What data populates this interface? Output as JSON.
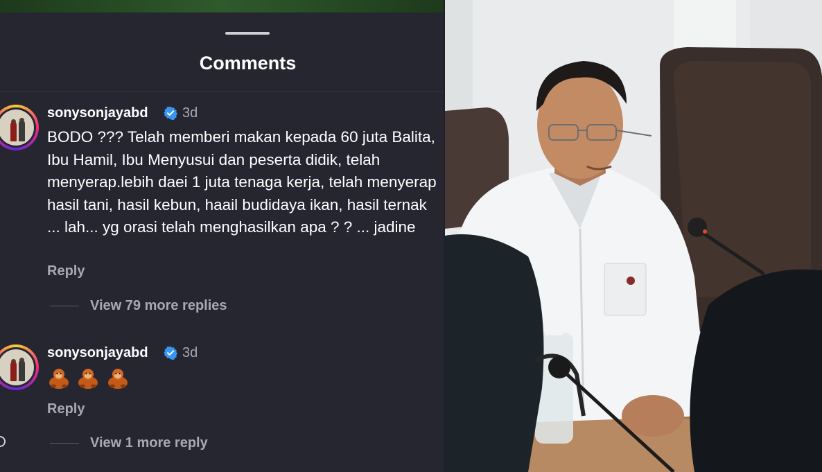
{
  "panel": {
    "title": "Comments"
  },
  "comments": [
    {
      "username": "sonysonjayabd",
      "verified": true,
      "time": "3d",
      "text": "BODO ??? Telah memberi makan kepada 60 juta Balita, Ibu Hamil, Ibu Menyusui dan peserta didik, telah menyerap.lebih daei 1 juta tenaga kerja, telah menyerap hasil tani, hasil kebun, haail budidaya ikan, hasil ternak ... lah... yg orasi telah menghasilkan apa ? ? ... jadine",
      "reply_label": "Reply",
      "view_replies_label": "View 79 more replies"
    },
    {
      "username": "sonysonjayabd",
      "verified": true,
      "time": "3d",
      "emojis": [
        "orangutan-icon",
        "orangutan-icon",
        "orangutan-icon"
      ],
      "reply_label": "Reply",
      "view_replies_label": "View 1 more reply"
    }
  ],
  "colors": {
    "panel_bg": "#262631",
    "verified_blue": "#3897f0",
    "muted_text": "#a9a9b3"
  }
}
